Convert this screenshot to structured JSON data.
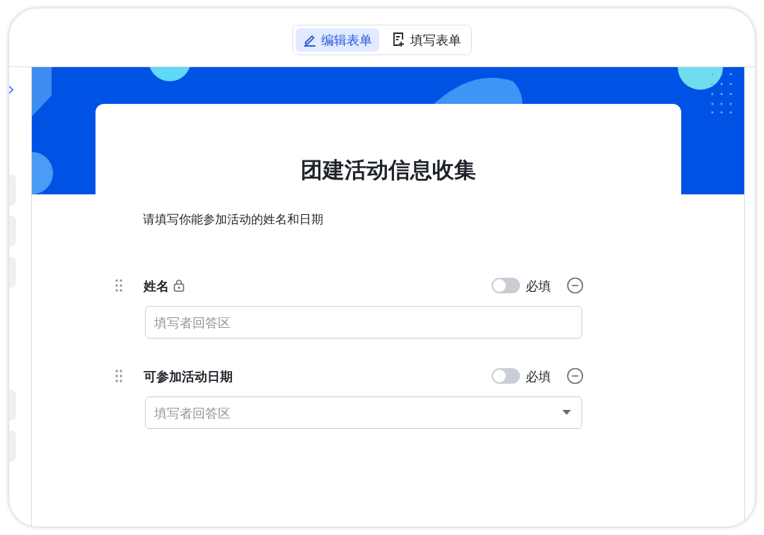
{
  "toolbar": {
    "tabs": [
      {
        "label": "编辑表单",
        "kind": "edit",
        "selected": true
      },
      {
        "label": "填写表单",
        "kind": "fill",
        "selected": false
      }
    ]
  },
  "form": {
    "title": "团建活动信息收集",
    "description": "请填写你能参加活动的姓名和日期",
    "fields": [
      {
        "label": "姓名",
        "kind": "text",
        "locked": true,
        "required": false,
        "required_label": "必填",
        "placeholder": "填写者回答区"
      },
      {
        "label": "可参加活动日期",
        "kind": "select",
        "locked": false,
        "required": false,
        "required_label": "必填",
        "placeholder": "填写者回答区"
      }
    ]
  }
}
